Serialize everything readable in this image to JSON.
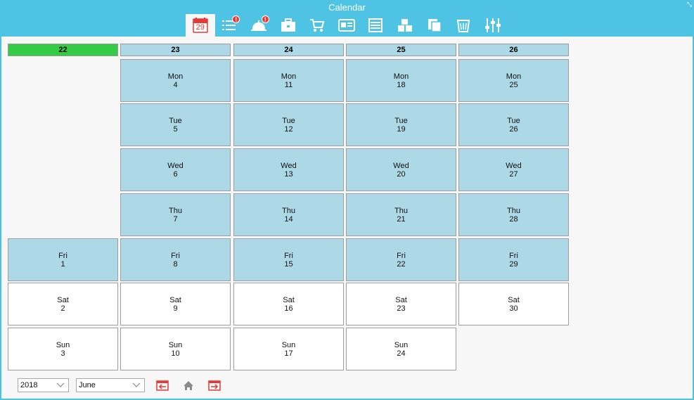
{
  "window": {
    "title": "Calendar"
  },
  "toolbar": {
    "calendar_day": "29",
    "alert_mark": "!",
    "icons": [
      "calendar-icon",
      "task-list-icon",
      "service-bell-icon",
      "briefcase-icon",
      "cart-icon",
      "id-card-icon",
      "ledger-icon",
      "boxes-icon",
      "documents-icon",
      "trash-bin-icon",
      "sliders-icon"
    ]
  },
  "weeks": [
    "22",
    "23",
    "24",
    "25",
    "26"
  ],
  "days": [
    [
      {
        "d": "Fri",
        "n": "1"
      },
      {
        "d": "Sat",
        "n": "2"
      },
      {
        "d": "Sun",
        "n": "3"
      }
    ],
    [
      {
        "d": "Mon",
        "n": "4"
      },
      {
        "d": "Tue",
        "n": "5"
      },
      {
        "d": "Wed",
        "n": "6"
      },
      {
        "d": "Thu",
        "n": "7"
      },
      {
        "d": "Fri",
        "n": "8"
      },
      {
        "d": "Sat",
        "n": "9"
      },
      {
        "d": "Sun",
        "n": "10"
      }
    ],
    [
      {
        "d": "Mon",
        "n": "11"
      },
      {
        "d": "Tue",
        "n": "12"
      },
      {
        "d": "Wed",
        "n": "13"
      },
      {
        "d": "Thu",
        "n": "14"
      },
      {
        "d": "Fri",
        "n": "15"
      },
      {
        "d": "Sat",
        "n": "16"
      },
      {
        "d": "Sun",
        "n": "17"
      }
    ],
    [
      {
        "d": "Mon",
        "n": "18"
      },
      {
        "d": "Tue",
        "n": "19"
      },
      {
        "d": "Wed",
        "n": "20"
      },
      {
        "d": "Thu",
        "n": "21"
      },
      {
        "d": "Fri",
        "n": "22"
      },
      {
        "d": "Sat",
        "n": "23"
      },
      {
        "d": "Sun",
        "n": "24"
      }
    ],
    [
      {
        "d": "Mon",
        "n": "25"
      },
      {
        "d": "Tue",
        "n": "26"
      },
      {
        "d": "Wed",
        "n": "27"
      },
      {
        "d": "Thu",
        "n": "28"
      },
      {
        "d": "Fri",
        "n": "29"
      },
      {
        "d": "Sat",
        "n": "30"
      }
    ]
  ],
  "footer": {
    "year": "2018",
    "month": "June"
  },
  "colors": {
    "accent": "#4fc3e3",
    "current_week": "#33cc44",
    "weekday_cell": "#add8e6",
    "nav_red": "#e53935"
  }
}
